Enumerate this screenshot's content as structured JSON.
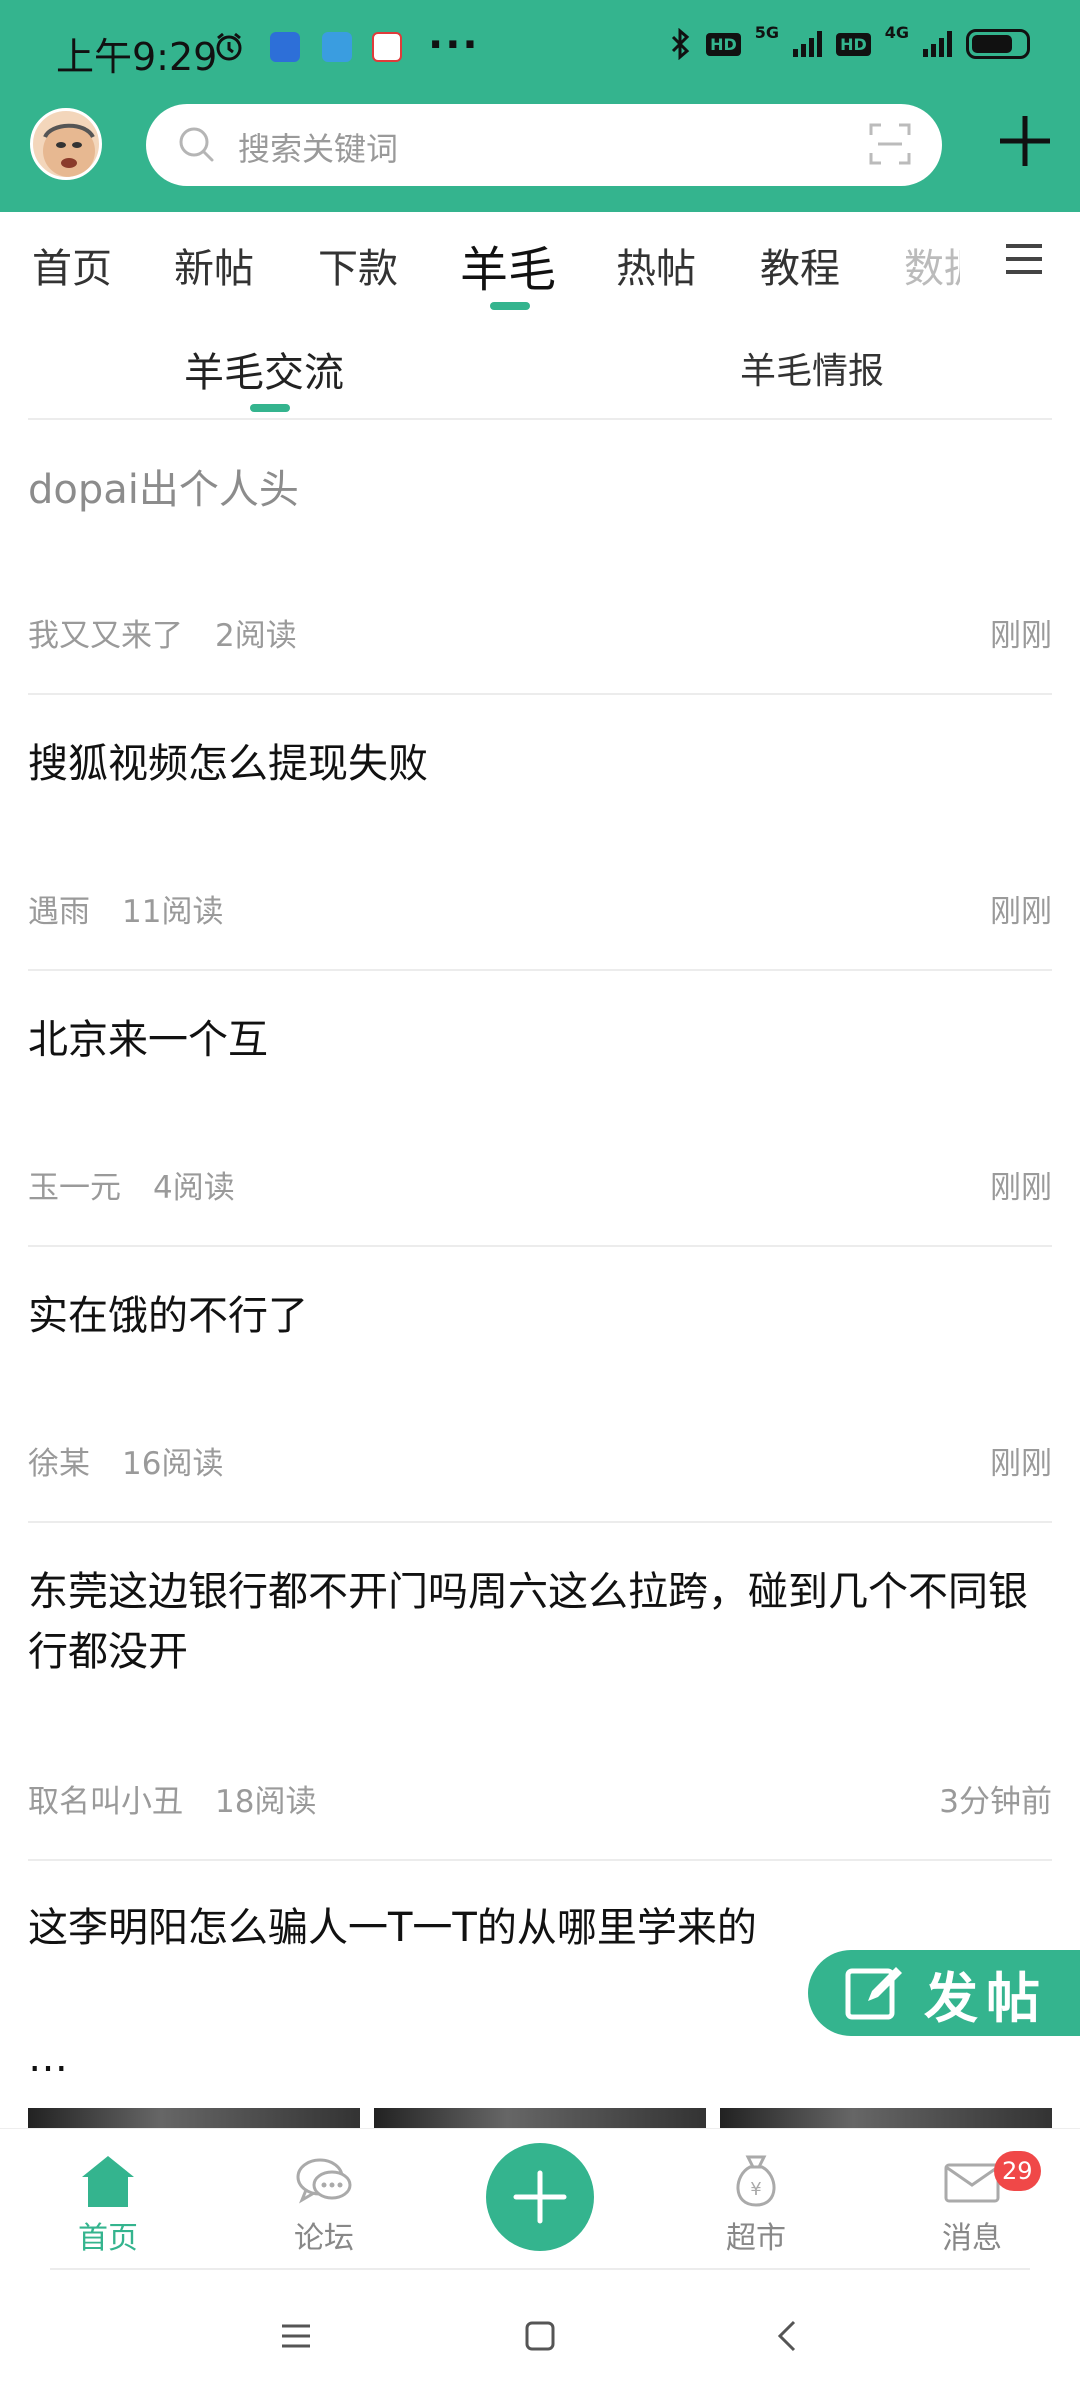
{
  "status_bar": {
    "time": "上午9:29",
    "more": "···",
    "hd1": "HD",
    "net1": "5G",
    "hd2": "HD",
    "net2": "4G",
    "battery_level": 0.76
  },
  "header": {
    "search_placeholder": "搜索关键词"
  },
  "category_tabs": [
    {
      "label": "首页"
    },
    {
      "label": "新帖"
    },
    {
      "label": "下款"
    },
    {
      "label": "羊毛",
      "active": true
    },
    {
      "label": "热帖"
    },
    {
      "label": "教程"
    },
    {
      "label": "数据"
    }
  ],
  "sub_tabs": [
    {
      "label": "羊毛交流",
      "active": true
    },
    {
      "label": "羊毛情报"
    }
  ],
  "posts": [
    {
      "title": "dopai出个人头",
      "author": "我又又来了",
      "reads": "2阅读",
      "time": "刚刚",
      "read": true
    },
    {
      "title": "搜狐视频怎么提现失败",
      "author": "遇雨",
      "reads": "11阅读",
      "time": "刚刚"
    },
    {
      "title": "北京来一个互",
      "author": "玉一元",
      "reads": "4阅读",
      "time": "刚刚"
    },
    {
      "title": "实在饿的不行了",
      "author": "徐某",
      "reads": "16阅读",
      "time": "刚刚"
    },
    {
      "title": "东莞这边银行都不开门吗周六这么拉跨，碰到几个不同银行都没开",
      "author": "取名叫小丑",
      "reads": "18阅读",
      "time": "3分钟前"
    },
    {
      "title": "这李明阳怎么骗人一T一T的从哪里学来的",
      "excerpt": "…"
    }
  ],
  "fab": {
    "label": "发帖"
  },
  "bottom_nav": [
    {
      "label": "首页",
      "icon": "home-icon",
      "active": true
    },
    {
      "label": "论坛",
      "icon": "chat-bubbles-icon"
    },
    {
      "label": "",
      "icon": "plus-icon"
    },
    {
      "label": "超市",
      "icon": "money-bag-icon"
    },
    {
      "label": "消息",
      "icon": "mail-icon",
      "badge": "29"
    }
  ],
  "colors": {
    "accent": "#34b48e",
    "badge": "#f04848"
  }
}
